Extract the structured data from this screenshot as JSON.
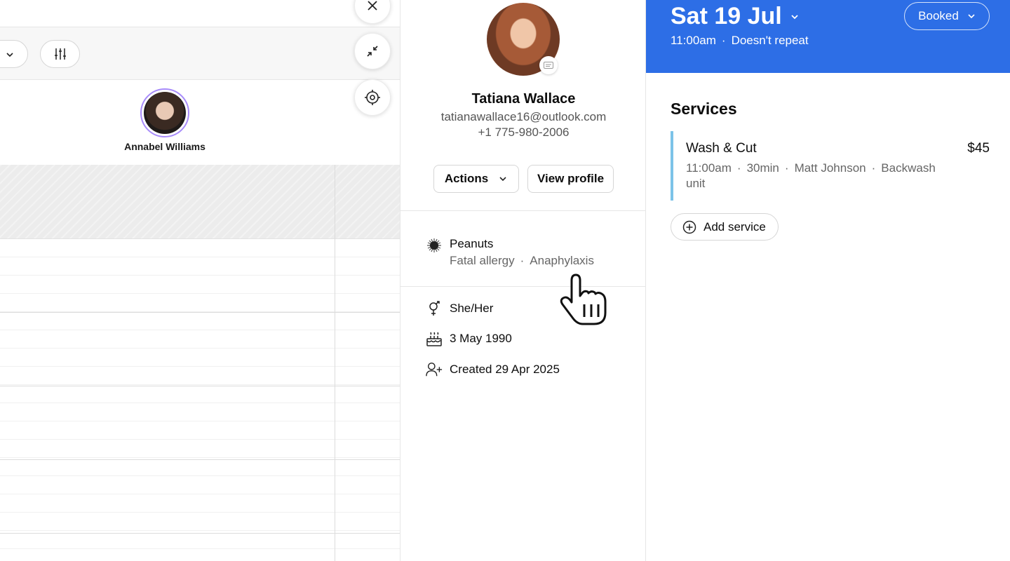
{
  "calendar": {
    "staff": [
      {
        "name": "Annabel Williams"
      }
    ]
  },
  "client": {
    "name": "Tatiana Wallace",
    "email": "tatianawallace16@outlook.com",
    "phone": "+1 775-980-2006",
    "actions_label": "Actions",
    "view_profile_label": "View profile",
    "allergy": {
      "title": "Peanuts",
      "severity": "Fatal allergy",
      "reaction": "Anaphylaxis"
    },
    "pronouns": "She/Her",
    "birthday": "3 May 1990",
    "created": "Created 29 Apr 2025"
  },
  "appointment": {
    "date": "Sat 19 Jul",
    "time": "11:00am",
    "repeat": "Doesn't repeat",
    "status": "Booked",
    "header_color": "#2d6ee6",
    "services_title": "Services",
    "services": [
      {
        "name": "Wash & Cut",
        "price": "$45",
        "time": "11:00am",
        "duration": "30min",
        "staff": "Matt Johnson",
        "resource": "Backwash unit",
        "accent": "#7cc3e8"
      }
    ],
    "add_service_label": "Add service"
  }
}
